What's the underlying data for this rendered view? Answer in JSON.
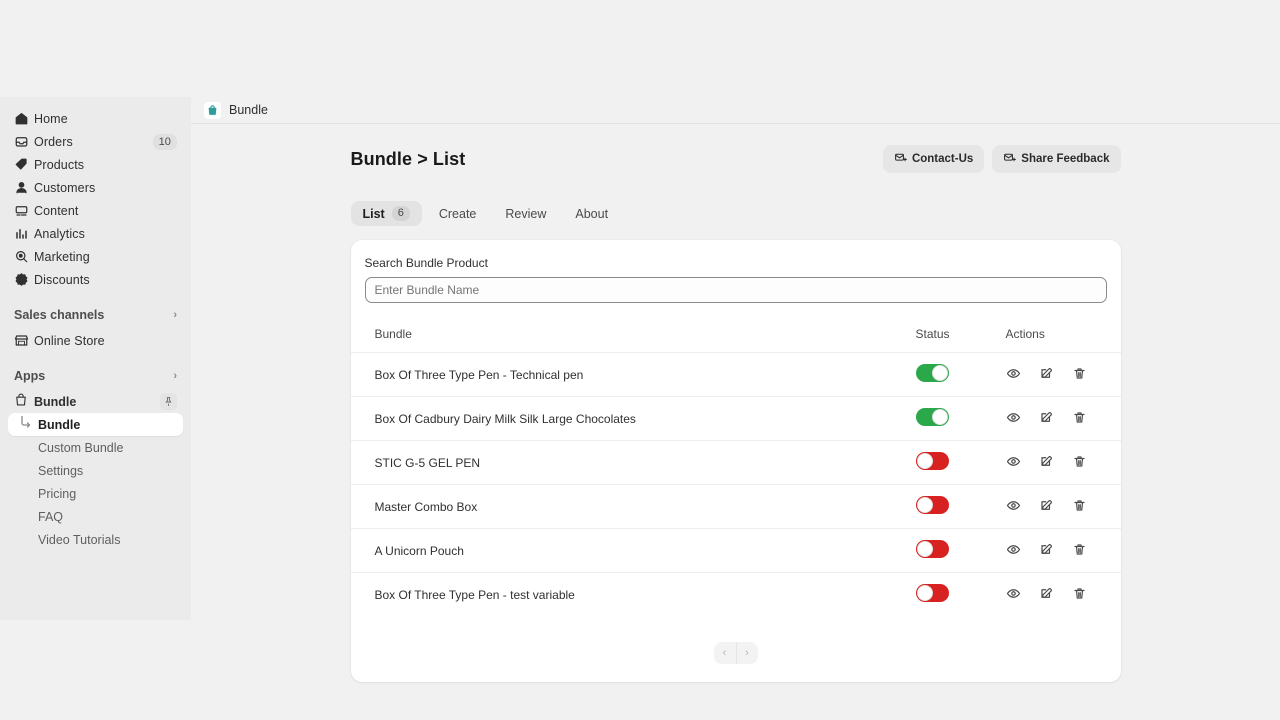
{
  "sidebar": {
    "nav": [
      {
        "label": "Home",
        "icon": "home-icon"
      },
      {
        "label": "Orders",
        "icon": "orders-inbox-icon",
        "badge": "10"
      },
      {
        "label": "Products",
        "icon": "tag-icon"
      },
      {
        "label": "Customers",
        "icon": "person-icon"
      },
      {
        "label": "Content",
        "icon": "content-icon"
      },
      {
        "label": "Analytics",
        "icon": "bar-chart-icon"
      },
      {
        "label": "Marketing",
        "icon": "megaphone-target-icon"
      },
      {
        "label": "Discounts",
        "icon": "discount-badge-icon"
      }
    ],
    "sales_channels": {
      "label": "Sales channels",
      "chevron": "chevron-right-icon"
    },
    "online_store": {
      "label": "Online Store",
      "icon": "storefront-icon"
    },
    "apps": {
      "label": "Apps",
      "chevron": "chevron-right-icon"
    },
    "app": {
      "label": "Bundle",
      "icon": "shopping-bag-icon",
      "pin_icon": "pushpin-icon",
      "items": [
        {
          "label": "Bundle",
          "active": true
        },
        {
          "label": "Custom Bundle",
          "active": false
        },
        {
          "label": "Settings",
          "active": false
        },
        {
          "label": "Pricing",
          "active": false
        },
        {
          "label": "FAQ",
          "active": false
        },
        {
          "label": "Video Tutorials",
          "active": false
        }
      ]
    }
  },
  "topbar": {
    "title": "Bundle",
    "icon": "shopping-bag-icon"
  },
  "page": {
    "title": "Bundle > List",
    "buttons": [
      {
        "label": "Contact-Us",
        "icon": "envelope-plus-icon"
      },
      {
        "label": "Share Feedback",
        "icon": "envelope-plus-icon"
      }
    ],
    "tabs": [
      {
        "label": "List",
        "count": "6",
        "active": true
      },
      {
        "label": "Create",
        "count": null,
        "active": false
      },
      {
        "label": "Review",
        "count": null,
        "active": false
      },
      {
        "label": "About",
        "count": null,
        "active": false
      }
    ],
    "search": {
      "label": "Search Bundle Product",
      "placeholder": "Enter Bundle Name",
      "value": ""
    },
    "table": {
      "columns": [
        "Bundle",
        "Status",
        "Actions"
      ],
      "rows": [
        {
          "name": "Box Of Three Type Pen - Technical pen",
          "status": "on"
        },
        {
          "name": "Box Of Cadbury Dairy Milk Silk Large Chocolates",
          "status": "on"
        },
        {
          "name": "STIC G-5 GEL PEN",
          "status": "off"
        },
        {
          "name": "Master Combo Box",
          "status": "off"
        },
        {
          "name": "A Unicorn Pouch",
          "status": "off"
        },
        {
          "name": "Box Of Three Type Pen - test variable",
          "status": "off"
        }
      ],
      "row_actions": [
        {
          "name": "view-action",
          "icon": "eye-icon"
        },
        {
          "name": "edit-action",
          "icon": "edit-pencil-icon"
        },
        {
          "name": "delete-action",
          "icon": "trash-icon"
        }
      ]
    },
    "pagination": {
      "prev_icon": "chevron-left-icon",
      "next_icon": "chevron-right-icon"
    }
  },
  "colors": {
    "toggle_on": "#2ba84a",
    "toggle_off": "#d82121",
    "app_icon": "#2e9e9b",
    "page_bg": "#f1f1f1",
    "sidebar_bg": "#ebebeb",
    "card_bg": "#ffffff"
  }
}
